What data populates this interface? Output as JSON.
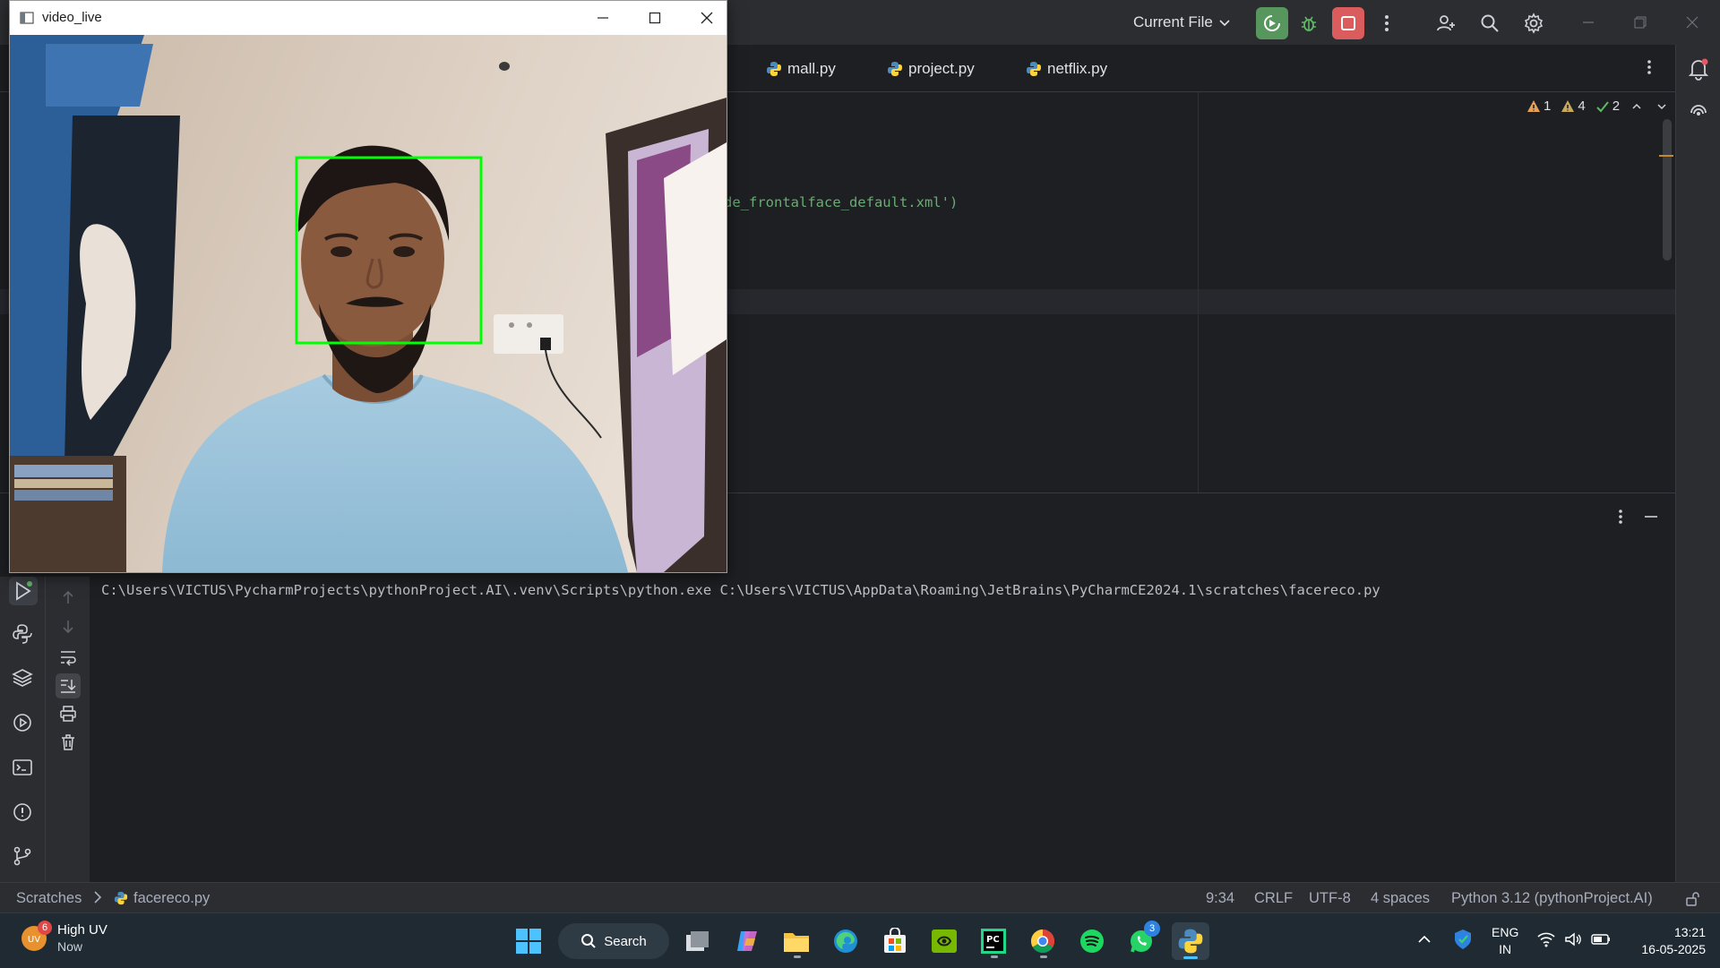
{
  "camera_window": {
    "title": "video_live",
    "detection_color": "#00ff00"
  },
  "ide": {
    "run_config": "Current File",
    "tabs": [
      {
        "label": "mall.py"
      },
      {
        "label": "project.py"
      },
      {
        "label": "netflix.py"
      }
    ],
    "code": {
      "visible_fragment": "de_frontalface_default.xml')"
    },
    "inspections": {
      "errors": "1",
      "warnings": "4",
      "weak_warnings": "2"
    },
    "console": {
      "command": "C:\\Users\\VICTUS\\PycharmProjects\\pythonProject.AI\\.venv\\Scripts\\python.exe C:\\Users\\VICTUS\\AppData\\Roaming\\JetBrains\\PyCharmCE2024.1\\scratches\\facereco.py"
    },
    "statusbar": {
      "breadcrumb_root": "Scratches",
      "breadcrumb_file": "facereco.py",
      "position": "9:34",
      "line_sep": "CRLF",
      "encoding": "UTF-8",
      "indent": "4 spaces",
      "interpreter": "Python 3.12 (pythonProject.AI)"
    }
  },
  "taskbar": {
    "weather_title": "High UV",
    "weather_sub": "Now",
    "weather_badge": "6",
    "search_label": "Search",
    "whatsapp_badge": "3",
    "lang_top": "ENG",
    "lang_bottom": "IN",
    "time": "13:21",
    "date": "16-05-2025"
  },
  "colors": {
    "ide_bg": "#1e1f22",
    "ide_chrome": "#2b2d30",
    "run_green": "#57965c",
    "stop_red": "#db5c5c",
    "taskbar_bg": "#1f2a33"
  }
}
